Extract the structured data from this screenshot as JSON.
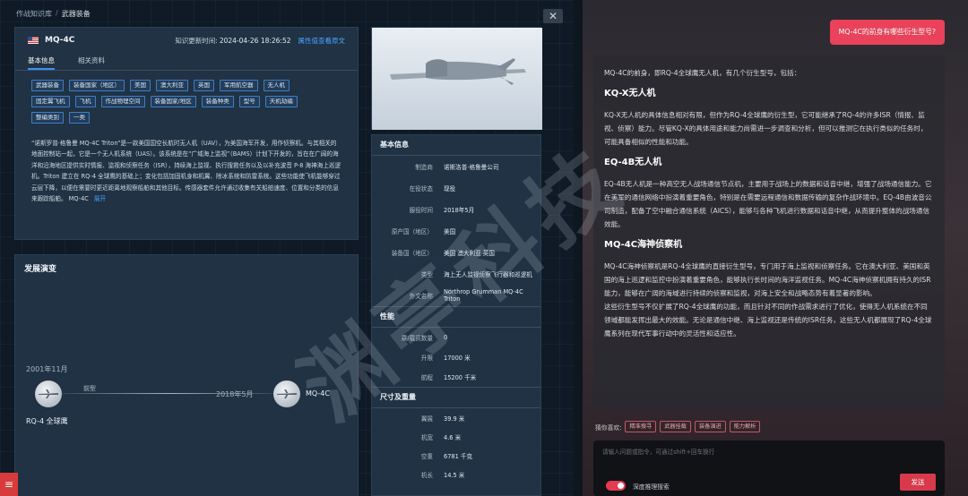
{
  "breadcrumb": [
    "作战知识库",
    "武器装备"
  ],
  "breadcrumb_sep": "/",
  "close_label": "✕",
  "info": {
    "title": "MQ-4C",
    "update_label": "知识更新时间:",
    "update_time": "2024-04-26 18:26:52",
    "related_link": "属性值查看原文",
    "tabs": [
      "基本信息",
      "相关资料"
    ],
    "tags": [
      "武器装备",
      "装备国家（地区）",
      "美国",
      "澳大利亚",
      "英国",
      "军用航空器",
      "无人机",
      "固定翼飞机",
      "飞机",
      "作战物理空间",
      "装备国家/地区",
      "装备种类",
      "型号",
      "天机劫编",
      "整编类别",
      "一类"
    ],
    "description": "“诺斯罗普·格鲁曼 MQ-4C Triton”是一款美国国空长航时无人机（UAV），为美国海军开发，用作侦察机。与其相关的地面控制站一起，它是一个无人机系统（UAS）。该系统是在“广域海上监视”（BAMS）计划下开发的，旨在在广阔的海洋和沿海地区提供实时情报、监视和侦察任务（ISR），持续海上监视、执行搜救任务以及以补充波音 P-8 海神海上巡逻机。Triton 建立在 RQ-4 全球鹰的基础上；变化包括加固机身和机翼、除冰系统和防雷系统。这些功能使飞机能够穿过云层下降，以便在需要时更近距离地观察船舶和其他目标。传感器套件允许通过收集有关船舶速度、位置和分类的信息来跟踪船舶。 MQ-4C",
    "more": "展开"
  },
  "development": {
    "title": "发展演变",
    "left_year": "2001年11月",
    "left_name": "RQ-4 全球鹰",
    "relation": "前型",
    "right_year": "2018年5月",
    "right_name": "MQ-4C"
  },
  "specs": {
    "basic_title": "基本信息",
    "basic": [
      {
        "k": "制造商",
        "v": "诺斯洛普·格鲁曼公司"
      },
      {
        "k": "在役状态",
        "v": "现役"
      },
      {
        "k": "服役时间",
        "v": "2018年5月"
      },
      {
        "k": "原产国（地区）",
        "v": "美国"
      },
      {
        "k": "装备国（地区）",
        "v": "美国 澳大利亚 英国"
      },
      {
        "k": "类型",
        "v": "海上无人监视侦察飞行器和巡逻机"
      },
      {
        "k": "外文名称",
        "v": "Northrop Grumman MQ-4C Triton"
      }
    ],
    "perf_title": "性能",
    "perf": [
      {
        "k": "乘/载员数量",
        "v": "0"
      },
      {
        "k": "升限",
        "v": "17000 米"
      },
      {
        "k": "航程",
        "v": "15200 千米"
      }
    ],
    "size_title": "尺寸及重量",
    "size": [
      {
        "k": "翼展",
        "v": "39.9 米"
      },
      {
        "k": "机宽",
        "v": "4.6 米"
      },
      {
        "k": "空重",
        "v": "6781 千克"
      },
      {
        "k": "机长",
        "v": "14.5 米"
      }
    ]
  },
  "chat": {
    "question": "MQ-4C的前身有哪些衍生型号?",
    "intro": "MQ-4C的前身，即RQ-4全球鹰无人机，有几个衍生型号，包括：",
    "sections": [
      {
        "title": "KQ-X无人机",
        "body": "KQ-X无人机的具体信息相对有限，但作为RQ-4全球鹰的衍生型，它可能继承了RQ-4的许多ISR（情报、监视、侦察）能力。尽管KQ-X的具体用途和能力尚需进一步调查和分析，但可以推测它在执行类似的任务时，可能具备相似的性能和功能。"
      },
      {
        "title": "EQ-4B无人机",
        "body": "EQ-4B无人机是一种高空无人战场通信节点机，主要用于战场上的数据和话音中继，增强了战场通信能力。它在美军的通信网络中扮演着重要角色，特别是在需要远程通信和数据传输的复杂作战环境中。EQ-4B由波音公司制造，配备了空中融合通信系统（AICS），能够与各种飞机进行数据和话音中继，从而提升整体的战场通信效能。"
      },
      {
        "title": "MQ-4C海神侦察机",
        "body": "MQ-4C海神侦察机是RQ-4全球鹰的直接衍生型号，专门用于海上监视和侦察任务。它在澳大利亚、美国和英国的海上巡逻和监控中扮演着重要角色，能够执行长时间的海洋监视任务。MQ-4C海神侦察机拥有持久的ISR能力，能够在广阔的海域进行持续的侦察和监视，对海上安全和战略态势有着显著的影响。"
      }
    ],
    "conclusion": "这些衍生型号不仅扩展了RQ-4全球鹰的功能，而且针对不同的作战需求进行了优化，使得无人机系统在不同领域都能发挥出最大的效能。无论是通信中继、海上监视还是传统的ISR任务，这些无人机都展现了RQ-4全球鹰系列在现代军事行动中的灵活性和适应性。",
    "suggest_label": "猜你喜欢:",
    "suggestions": [
      "精准搜寻",
      "武器挂载",
      "装备演进",
      "能力解析"
    ],
    "placeholder": "请输入问题或指令，可通过shift+回车换行",
    "toggle_label": "深度推理搜索",
    "send_label": "发送"
  },
  "watermark": "渊亭科技",
  "menu_label": "≡"
}
